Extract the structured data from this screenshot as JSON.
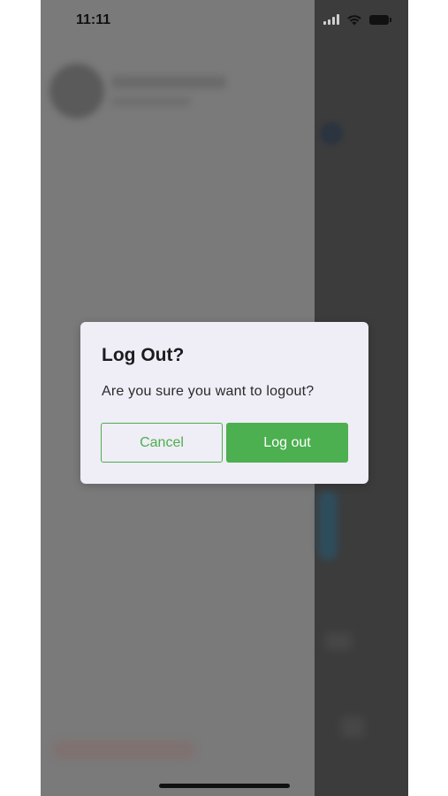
{
  "status_bar": {
    "time": "11:11",
    "icons": [
      "signal-icon",
      "wifi-icon",
      "battery-icon"
    ]
  },
  "dialog": {
    "title": "Log Out?",
    "message": "Are you sure you want to logout?",
    "cancel_label": "Cancel",
    "confirm_label": "Log out"
  },
  "colors": {
    "accent": "#4caf50",
    "dialog_background": "#efedf5",
    "overlay": "#7a7a7a"
  }
}
